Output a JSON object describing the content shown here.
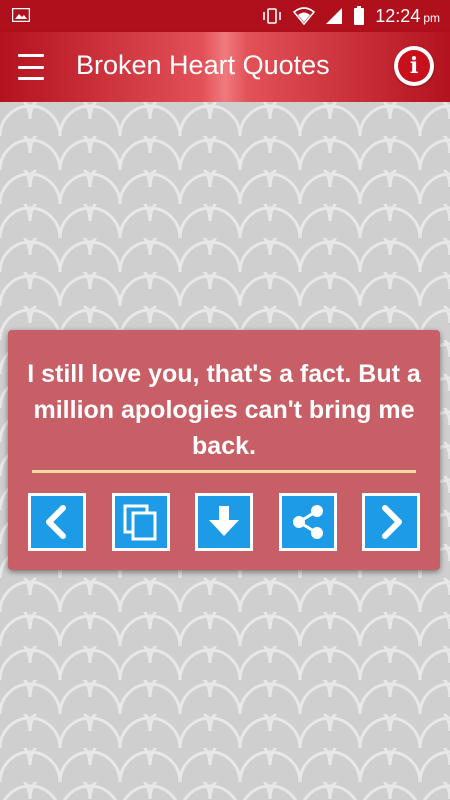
{
  "status_bar": {
    "time": "12:24",
    "ampm": "pm"
  },
  "app_bar": {
    "title": "Broken Heart Quotes",
    "info_glyph": "i"
  },
  "quote": {
    "text": "I still love you, that's a fact. But a million apologies can't bring me back."
  },
  "actions": [
    "previous-icon",
    "copy-icon",
    "download-icon",
    "share-icon",
    "next-icon"
  ],
  "colors": {
    "status_bar": "#b0101c",
    "app_bar_dark": "#b3121e",
    "app_bar_light": "#f07a7f",
    "background": "#cfcfcf",
    "card": "#c85f66",
    "divider": "#f2d9a0",
    "action_button": "#1e9be6"
  }
}
